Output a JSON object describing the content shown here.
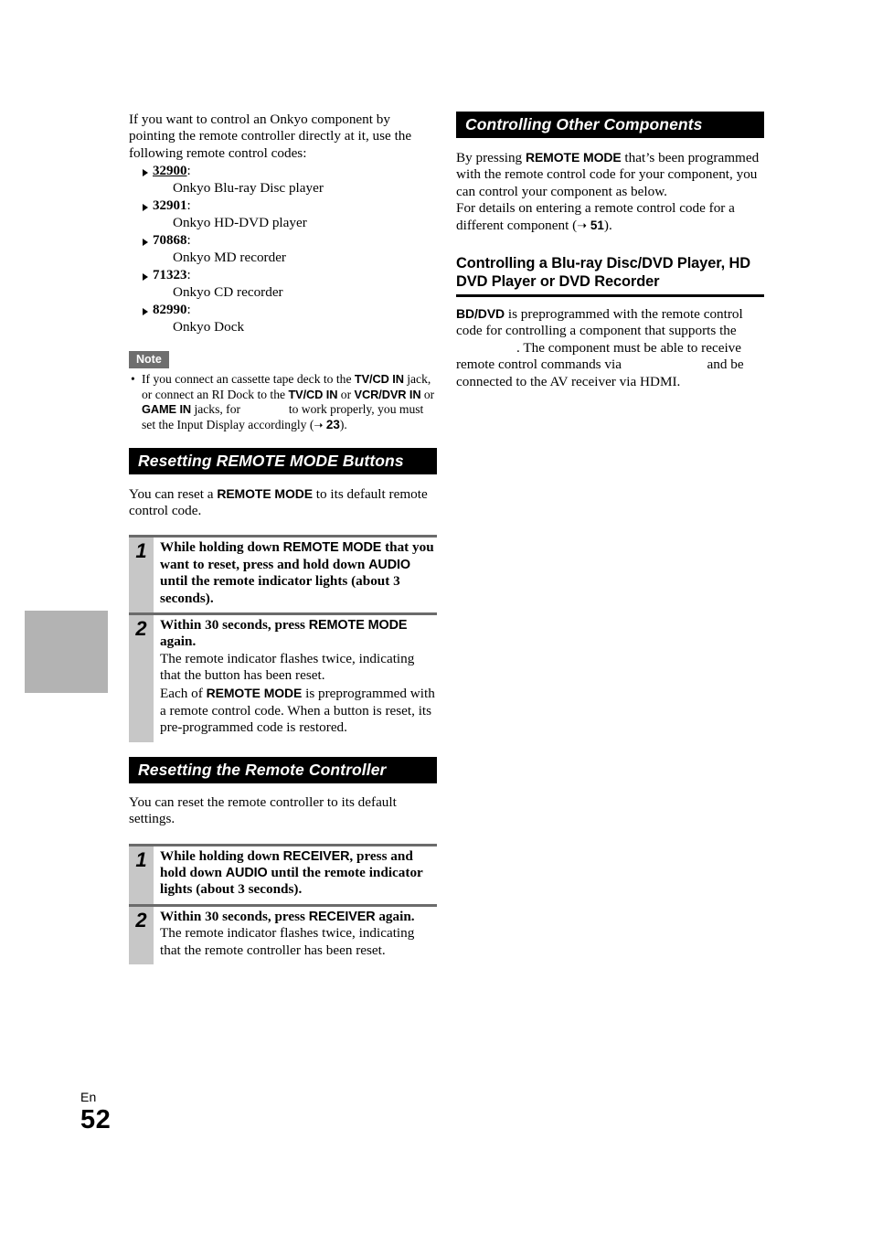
{
  "page": {
    "language_code": "En",
    "number": "52",
    "thumb_index_name": "chapter-thumb-index"
  },
  "left_column": {
    "intro": {
      "text_before": "If you want to control an Onkyo component by pointing the remote controller directly at it, use the following remote control codes:"
    },
    "codes": [
      {
        "code": "32900",
        "underlined": true,
        "colon": ":",
        "description": "Onkyo Blu-ray Disc player"
      },
      {
        "code": "32901",
        "underlined": false,
        "colon": ":",
        "description": "Onkyo HD-DVD player"
      },
      {
        "code": "70868",
        "underlined": false,
        "colon": ":",
        "description": "Onkyo MD recorder"
      },
      {
        "code": "71323",
        "underlined": false,
        "colon": ":",
        "description": "Onkyo CD recorder"
      },
      {
        "code": "82990",
        "underlined": false,
        "colon": ":",
        "description": "Onkyo Dock"
      }
    ],
    "note": {
      "label": "Note",
      "bullet": "•",
      "seg1": "If you connect an cassette tape deck to the ",
      "ui1": "TV/CD IN",
      "seg2": " jack, or connect an RI Dock to the ",
      "ui2": "TV/CD IN",
      "seg3": " or ",
      "ui3": "VCR/DVR IN",
      "seg4": " or ",
      "ui4": "GAME IN",
      "seg5": " jacks, for ",
      "seg6": " to work properly, you must set the Input Display accordingly (",
      "ref_arrow": "➝",
      "ref_page": "23",
      "seg7": ")."
    },
    "section_reset_mode": {
      "banner": "Resetting REMOTE MODE Buttons",
      "intro_seg1": "You can reset a ",
      "intro_ui": "REMOTE MODE",
      "intro_seg2": " to its default remote control code.",
      "steps": [
        {
          "number": "1",
          "lead_seg1": "While holding down ",
          "lead_ui1": "REMOTE MODE",
          "lead_seg2": " that you want to reset, press and hold down ",
          "lead_ui2": "AUDIO",
          "lead_seg3": " until the remote indicator lights (about 3 seconds).",
          "paras": []
        },
        {
          "number": "2",
          "lead_seg1": "Within 30 seconds, press ",
          "lead_ui1": "REMOTE MODE",
          "lead_seg2": " again.",
          "paras": [
            {
              "text": "The remote indicator flashes twice, indicating that the button has been reset."
            },
            {
              "seg1": "Each of ",
              "ui1": "REMOTE MODE",
              "seg2": " is preprogrammed with a remote control code. When a button is reset, its pre-programmed code is restored."
            }
          ]
        }
      ]
    },
    "section_reset_remote": {
      "banner": "Resetting the Remote Controller",
      "intro": "You can reset the remote controller to its default settings.",
      "steps": [
        {
          "number": "1",
          "lead_seg1": "While holding down ",
          "lead_ui1": "RECEIVER",
          "lead_seg2": ", press and hold down ",
          "lead_ui2": "AUDIO",
          "lead_seg3": " until the remote indicator lights (about 3 seconds).",
          "paras": []
        },
        {
          "number": "2",
          "lead_seg1": "Within 30 seconds, press ",
          "lead_ui1": "RECEIVER",
          "lead_seg2": " again.",
          "paras": [
            {
              "text": "The remote indicator flashes twice, indicating that the remote controller has been reset."
            }
          ]
        }
      ]
    }
  },
  "right_column": {
    "banner": "Controlling Other Components",
    "intro_seg1": "By pressing ",
    "intro_ui": "REMOTE MODE",
    "intro_seg2": " that’s been programmed with the remote control code for your component, you can control your component as below.",
    "intro2_seg1": "For details on entering a remote control code for a different component (",
    "intro2_arrow": "➝",
    "intro2_page": "51",
    "intro2_seg2": ").",
    "subsection": {
      "heading": "Controlling a Blu-ray Disc/DVD Player, HD DVD Player or DVD Recorder",
      "body_ui": "BD/DVD",
      "body_seg1": " is preprogrammed with the remote control code for controlling a component that supports the ",
      "body_seg2": ". The component must be able to receive remote control commands via ",
      "body_seg3": " and be connected to the AV receiver via HDMI."
    }
  }
}
